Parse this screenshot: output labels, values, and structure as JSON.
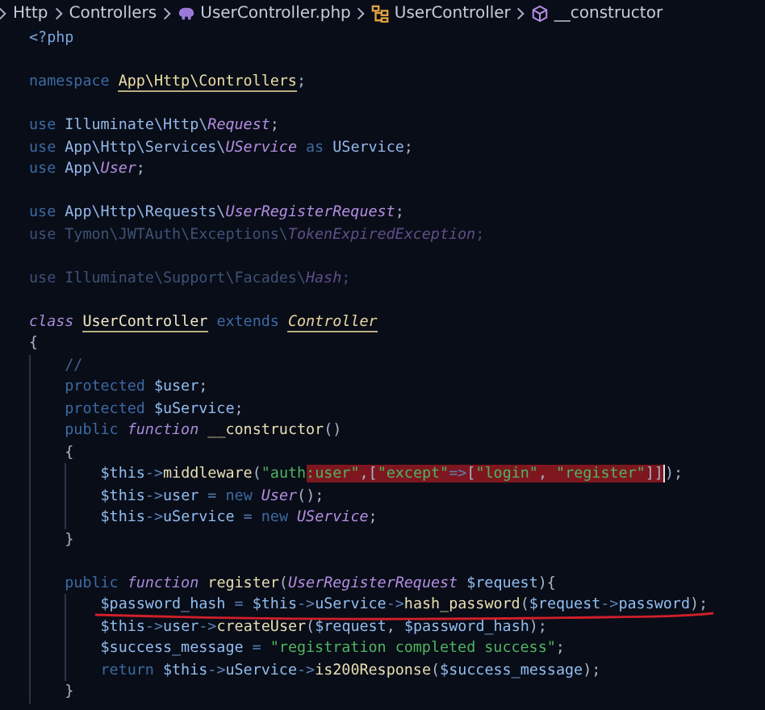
{
  "breadcrumb": [
    {
      "label": "Http"
    },
    {
      "label": "Controllers"
    },
    {
      "label": "UserController.php"
    },
    {
      "label": "UserController"
    },
    {
      "label": "__constructor"
    }
  ],
  "lines": [
    {
      "kind": "code",
      "tokens": [
        {
          "kind": "tag",
          "t": "<?php"
        }
      ]
    },
    {
      "kind": "blank"
    },
    {
      "kind": "code",
      "tokens": [
        {
          "kind": "kw",
          "t": "namespace "
        },
        {
          "kind": "ns",
          "t": "App\\Http\\Controllers"
        },
        {
          "kind": "punc",
          "t": ";"
        }
      ]
    },
    {
      "kind": "blank"
    },
    {
      "kind": "code",
      "tokens": [
        {
          "kind": "kw",
          "t": "use "
        },
        {
          "kind": "id",
          "t": "Illuminate\\Http\\"
        },
        {
          "kind": "type",
          "t": "Request"
        },
        {
          "kind": "punc",
          "t": ";"
        }
      ]
    },
    {
      "kind": "code",
      "tokens": [
        {
          "kind": "kw",
          "t": "use "
        },
        {
          "kind": "id",
          "t": "App\\Http\\Services\\"
        },
        {
          "kind": "type",
          "t": "UService"
        },
        {
          "kind": "kw",
          "t": " as "
        },
        {
          "kind": "id",
          "t": "UService"
        },
        {
          "kind": "punc",
          "t": ";"
        }
      ]
    },
    {
      "kind": "code",
      "tokens": [
        {
          "kind": "kw",
          "t": "use "
        },
        {
          "kind": "id",
          "t": "App\\"
        },
        {
          "kind": "type",
          "t": "User"
        },
        {
          "kind": "punc",
          "t": ";"
        }
      ]
    },
    {
      "kind": "blank"
    },
    {
      "kind": "code",
      "tokens": [
        {
          "kind": "kw",
          "t": "use "
        },
        {
          "kind": "id",
          "t": "App\\Http\\Requests\\"
        },
        {
          "kind": "type",
          "t": "UserRegisterRequest"
        },
        {
          "kind": "punc",
          "t": ";"
        }
      ]
    },
    {
      "kind": "code",
      "tokens": [
        {
          "kind": "faded",
          "t": "use Tymon\\JWTAuth\\Exceptions\\"
        },
        {
          "kind": "faded-type",
          "t": "TokenExpiredException"
        },
        {
          "kind": "faded",
          "t": ";"
        }
      ]
    },
    {
      "kind": "blank"
    },
    {
      "kind": "code",
      "tokens": [
        {
          "kind": "faded",
          "t": "use Illuminate\\Support\\Facades\\"
        },
        {
          "kind": "faded-type",
          "t": "Hash"
        },
        {
          "kind": "faded",
          "t": ";"
        }
      ]
    },
    {
      "kind": "blank"
    },
    {
      "kind": "code",
      "tokens": [
        {
          "kind": "kwi",
          "t": "class "
        },
        {
          "kind": "decl",
          "t": "UserController"
        },
        {
          "kind": "kw",
          "t": " extends "
        },
        {
          "kind": "decl-i",
          "t": "Controller"
        }
      ]
    },
    {
      "kind": "code",
      "tokens": [
        {
          "kind": "punc",
          "t": "{"
        }
      ]
    },
    {
      "kind": "block",
      "children": [
        {
          "kind": "code",
          "tokens": [
            {
              "kind": "comment",
              "t": "//"
            }
          ]
        },
        {
          "kind": "code",
          "tokens": [
            {
              "kind": "kw",
              "t": "protected "
            },
            {
              "kind": "var",
              "t": "$user"
            },
            {
              "kind": "punc",
              "t": ";"
            }
          ]
        },
        {
          "kind": "code",
          "tokens": [
            {
              "kind": "kw",
              "t": "protected "
            },
            {
              "kind": "var",
              "t": "$uService"
            },
            {
              "kind": "punc",
              "t": ";"
            }
          ]
        },
        {
          "kind": "code",
          "tokens": [
            {
              "kind": "kw",
              "t": "public "
            },
            {
              "kind": "kwi",
              "t": "function "
            },
            {
              "kind": "fn",
              "t": "__constructor"
            },
            {
              "kind": "punc",
              "t": "()"
            }
          ]
        },
        {
          "kind": "code",
          "tokens": [
            {
              "kind": "punc",
              "t": "{"
            }
          ]
        },
        {
          "kind": "block",
          "children": [
            {
              "kind": "code",
              "tokens": [
                {
                  "kind": "var",
                  "t": "$this"
                },
                {
                  "kind": "op",
                  "t": "->"
                },
                {
                  "kind": "fn",
                  "t": "middleware"
                },
                {
                  "kind": "punc",
                  "t": "("
                },
                {
                  "kind": "str",
                  "t": "\"auth"
                }
              ],
              "selection": [
                {
                  "kind": "str",
                  "t": ":user\""
                },
                {
                  "kind": "punc",
                  "t": ",["
                },
                {
                  "kind": "str",
                  "t": "\"except\""
                },
                {
                  "kind": "op",
                  "t": "=>"
                },
                {
                  "kind": "punc",
                  "t": "["
                },
                {
                  "kind": "str",
                  "t": "\"login\""
                },
                {
                  "kind": "punc",
                  "t": ", "
                },
                {
                  "kind": "str",
                  "t": "\"register\""
                },
                {
                  "kind": "punc",
                  "t": "]]"
                }
              ],
              "after": [
                {
                  "kind": "punc",
                  "t": ");"
                }
              ]
            },
            {
              "kind": "code",
              "tokens": [
                {
                  "kind": "var",
                  "t": "$this"
                },
                {
                  "kind": "op",
                  "t": "->"
                },
                {
                  "kind": "var",
                  "t": "user"
                },
                {
                  "kind": "op",
                  "t": " = "
                },
                {
                  "kind": "kw",
                  "t": "new "
                },
                {
                  "kind": "type",
                  "t": "User"
                },
                {
                  "kind": "punc",
                  "t": "();"
                }
              ]
            },
            {
              "kind": "code",
              "tokens": [
                {
                  "kind": "var",
                  "t": "$this"
                },
                {
                  "kind": "op",
                  "t": "->"
                },
                {
                  "kind": "var",
                  "t": "uService"
                },
                {
                  "kind": "op",
                  "t": " = "
                },
                {
                  "kind": "kw",
                  "t": "new "
                },
                {
                  "kind": "type",
                  "t": "UService"
                },
                {
                  "kind": "punc",
                  "t": ";"
                }
              ]
            }
          ]
        },
        {
          "kind": "code",
          "tokens": [
            {
              "kind": "punc",
              "t": "}"
            }
          ]
        },
        {
          "kind": "blank"
        },
        {
          "kind": "code",
          "tokens": [
            {
              "kind": "kw",
              "t": "public "
            },
            {
              "kind": "kwi",
              "t": "function "
            },
            {
              "kind": "fn",
              "t": "register"
            },
            {
              "kind": "punc",
              "t": "("
            },
            {
              "kind": "type",
              "t": "UserRegisterRequest "
            },
            {
              "kind": "var",
              "t": "$request"
            },
            {
              "kind": "punc",
              "t": "){"
            }
          ]
        },
        {
          "kind": "block",
          "children": [
            {
              "kind": "code",
              "underlined": true,
              "tokens": [
                {
                  "kind": "var",
                  "t": "$password_hash"
                },
                {
                  "kind": "op",
                  "t": " = "
                },
                {
                  "kind": "var",
                  "t": "$this"
                },
                {
                  "kind": "op",
                  "t": "->"
                },
                {
                  "kind": "var",
                  "t": "uService"
                },
                {
                  "kind": "op",
                  "t": "->"
                },
                {
                  "kind": "fn",
                  "t": "hash_password"
                },
                {
                  "kind": "punc",
                  "t": "("
                },
                {
                  "kind": "var",
                  "t": "$request"
                },
                {
                  "kind": "op",
                  "t": "->"
                },
                {
                  "kind": "var",
                  "t": "password"
                },
                {
                  "kind": "punc",
                  "t": ");"
                }
              ]
            },
            {
              "kind": "code",
              "tokens": [
                {
                  "kind": "var",
                  "t": "$this"
                },
                {
                  "kind": "op",
                  "t": "->"
                },
                {
                  "kind": "var",
                  "t": "user"
                },
                {
                  "kind": "op",
                  "t": "->"
                },
                {
                  "kind": "fn",
                  "t": "createUser"
                },
                {
                  "kind": "punc",
                  "t": "("
                },
                {
                  "kind": "var",
                  "t": "$request"
                },
                {
                  "kind": "punc",
                  "t": ", "
                },
                {
                  "kind": "var",
                  "t": "$password_hash"
                },
                {
                  "kind": "punc",
                  "t": ");"
                }
              ]
            },
            {
              "kind": "code",
              "tokens": [
                {
                  "kind": "var",
                  "t": "$success_message"
                },
                {
                  "kind": "op",
                  "t": " = "
                },
                {
                  "kind": "str",
                  "t": "\"registration completed success\""
                },
                {
                  "kind": "punc",
                  "t": ";"
                }
              ]
            },
            {
              "kind": "code",
              "tokens": [
                {
                  "kind": "kw",
                  "t": "return "
                },
                {
                  "kind": "var",
                  "t": "$this"
                },
                {
                  "kind": "op",
                  "t": "->"
                },
                {
                  "kind": "var",
                  "t": "uService"
                },
                {
                  "kind": "op",
                  "t": "->"
                },
                {
                  "kind": "fn",
                  "t": "is200Response"
                },
                {
                  "kind": "punc",
                  "t": "("
                },
                {
                  "kind": "var",
                  "t": "$success_message"
                },
                {
                  "kind": "punc",
                  "t": ");"
                }
              ]
            }
          ]
        },
        {
          "kind": "code",
          "tokens": [
            {
              "kind": "punc",
              "t": "}"
            }
          ]
        }
      ]
    }
  ]
}
